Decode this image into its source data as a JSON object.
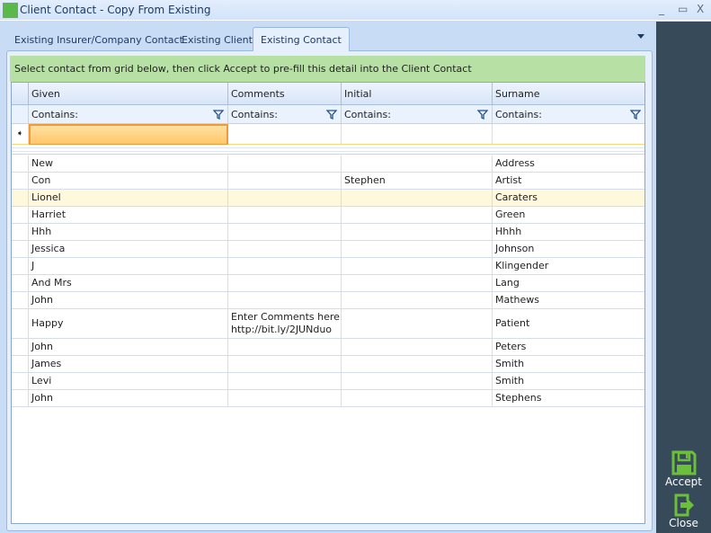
{
  "window": {
    "title": "Client Contact - Copy From Existing",
    "minimize": "_",
    "maximize": "▭",
    "close": "X"
  },
  "tabs": [
    {
      "label": "Existing Insurer/Company Contact"
    },
    {
      "label": "Existing Client"
    },
    {
      "label": "Existing Contact",
      "active": true
    }
  ],
  "banner": "Select contact from grid below, then click Accept to pre-fill this detail into the Client Contact",
  "grid": {
    "columns": [
      "Given",
      "Comments",
      "Initial",
      "Surname"
    ],
    "filter_label": "Contains:",
    "rows": [
      {
        "given": "New",
        "comments": "",
        "initial": "",
        "surname": "Address"
      },
      {
        "given": "Con",
        "comments": "",
        "initial": "Stephen",
        "surname": "Artist"
      },
      {
        "given": "Lionel",
        "comments": "",
        "initial": "",
        "surname": "Caraters"
      },
      {
        "given": "Harriet",
        "comments": "",
        "initial": "",
        "surname": "Green"
      },
      {
        "given": "Hhh",
        "comments": "",
        "initial": "",
        "surname": "Hhhh"
      },
      {
        "given": "Jessica",
        "comments": "",
        "initial": "",
        "surname": "Johnson"
      },
      {
        "given": "J",
        "comments": "",
        "initial": "",
        "surname": "Klingender"
      },
      {
        "given": "And Mrs",
        "comments": "",
        "initial": "",
        "surname": "Lang"
      },
      {
        "given": "John",
        "comments": "",
        "initial": "",
        "surname": "Mathews"
      },
      {
        "given": "Happy",
        "comments": "Enter Comments here...\nhttp://bit.ly/2JUNduo",
        "initial": "",
        "surname": "Patient"
      },
      {
        "given": "John",
        "comments": "",
        "initial": "",
        "surname": "Peters"
      },
      {
        "given": "James",
        "comments": "",
        "initial": "",
        "surname": "Smith"
      },
      {
        "given": "Levi",
        "comments": "",
        "initial": "",
        "surname": "Smith"
      },
      {
        "given": "John",
        "comments": "",
        "initial": "",
        "surname": "Stephens"
      }
    ]
  },
  "actions": {
    "accept": "Accept",
    "close": "Close"
  },
  "colors": {
    "accent": "#6cbf3a",
    "sidebar": "#374a59",
    "banner": "#b7e0a5"
  }
}
